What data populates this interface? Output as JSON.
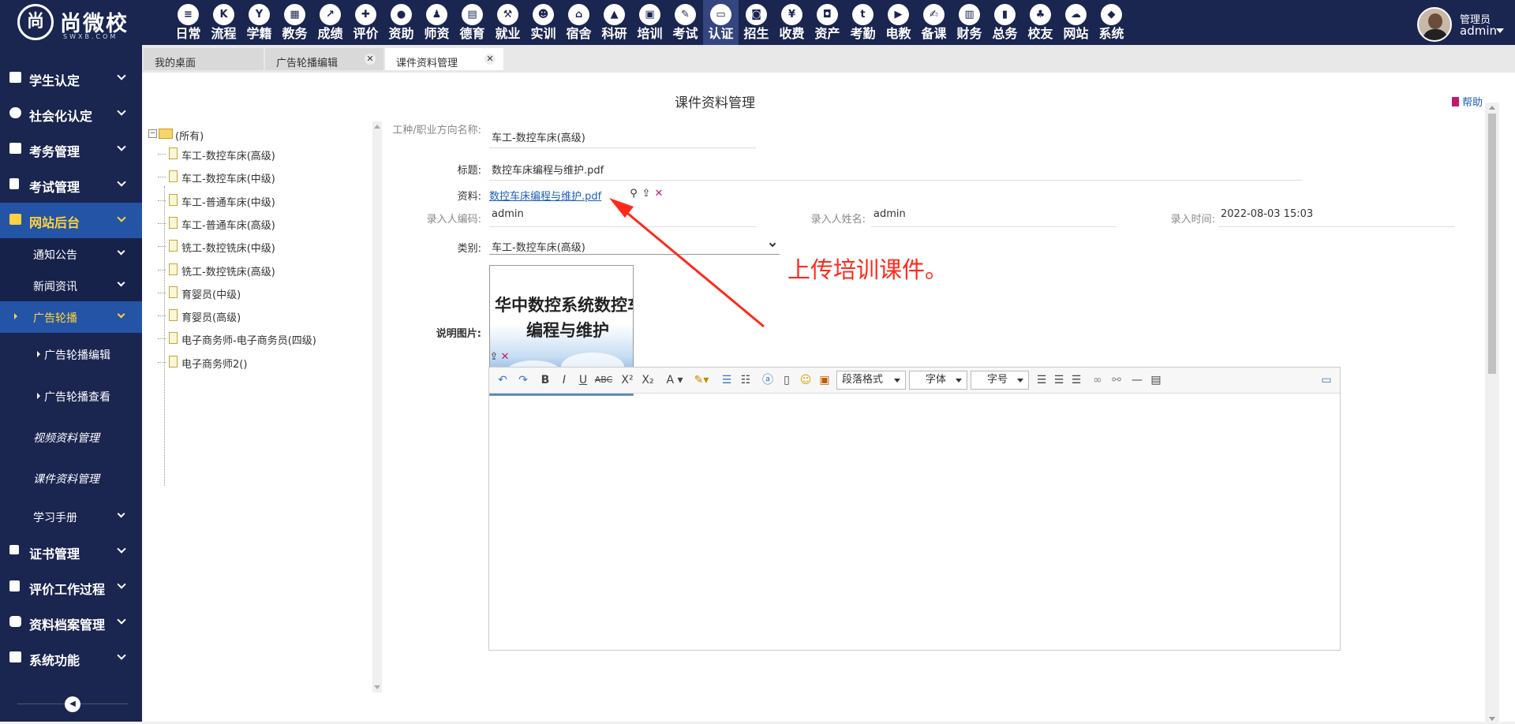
{
  "app": {
    "logo_text": "尚微校",
    "logo_sub": "SWXB.COM",
    "logo_mark": "尚"
  },
  "top_nav": [
    {
      "label": "日常",
      "icon": "doc-icon",
      "glyph": "≡"
    },
    {
      "label": "流程",
      "icon": "flow-icon",
      "glyph": "K"
    },
    {
      "label": "学籍",
      "icon": "student-icon",
      "glyph": "Y"
    },
    {
      "label": "教务",
      "icon": "calendar-icon",
      "glyph": "▦"
    },
    {
      "label": "成绩",
      "icon": "chart-icon",
      "glyph": "↗"
    },
    {
      "label": "评价",
      "icon": "evaluate-icon",
      "glyph": "✚"
    },
    {
      "label": "资助",
      "icon": "aid-icon",
      "glyph": "●"
    },
    {
      "label": "师资",
      "icon": "teacher-icon",
      "glyph": "♟"
    },
    {
      "label": "德育",
      "icon": "book-icon",
      "glyph": "▤"
    },
    {
      "label": "就业",
      "icon": "hammer-icon",
      "glyph": "⚒"
    },
    {
      "label": "实训",
      "icon": "train-icon",
      "glyph": "☻"
    },
    {
      "label": "宿舍",
      "icon": "home-icon",
      "glyph": "⌂"
    },
    {
      "label": "科研",
      "icon": "grad-cap-icon",
      "glyph": "▲"
    },
    {
      "label": "培训",
      "icon": "image-icon",
      "glyph": "▣"
    },
    {
      "label": "考试",
      "icon": "wrench-icon",
      "glyph": "✎"
    },
    {
      "label": "认证",
      "icon": "monitor-icon",
      "glyph": "▭"
    },
    {
      "label": "招生",
      "icon": "bus-icon",
      "glyph": "◙"
    },
    {
      "label": "收费",
      "icon": "yen-icon",
      "glyph": "¥"
    },
    {
      "label": "资产",
      "icon": "subway-icon",
      "glyph": "◘"
    },
    {
      "label": "考勤",
      "icon": "t-icon",
      "glyph": "t"
    },
    {
      "label": "电教",
      "icon": "video-doc-icon",
      "glyph": "▶"
    },
    {
      "label": "备课",
      "icon": "edit-icon",
      "glyph": "✍"
    },
    {
      "label": "财务",
      "icon": "newspaper-icon",
      "glyph": "▥"
    },
    {
      "label": "总务",
      "icon": "bar-chart-icon",
      "glyph": "▮"
    },
    {
      "label": "校友",
      "icon": "group-icon",
      "glyph": "♣"
    },
    {
      "label": "网站",
      "icon": "cloud-icon",
      "glyph": "☁"
    },
    {
      "label": "系统",
      "icon": "cube-icon",
      "glyph": "◆"
    }
  ],
  "active_nav": "认证",
  "user": {
    "role": "管理员",
    "name": "admin"
  },
  "sidebar": {
    "items": [
      {
        "label": "学生认定",
        "icon": "book-icon"
      },
      {
        "label": "社会化认定",
        "icon": "cloud-icon"
      },
      {
        "label": "考务管理",
        "icon": "mail-icon"
      },
      {
        "label": "考试管理",
        "icon": "file-icon"
      },
      {
        "label": "网站后台",
        "icon": "folder-icon"
      },
      {
        "label": "通知公告"
      },
      {
        "label": "新闻资讯"
      },
      {
        "label": "广告轮播"
      },
      {
        "label": "广告轮播编辑"
      },
      {
        "label": "广告轮播查看"
      },
      {
        "label": "视频资料管理"
      },
      {
        "label": "课件资料管理"
      },
      {
        "label": "学习手册"
      },
      {
        "label": "证书管理",
        "icon": "y-icon"
      },
      {
        "label": "评价工作过程",
        "icon": "columns-icon"
      },
      {
        "label": "资料档案管理",
        "icon": "circle-icon"
      },
      {
        "label": "系统功能",
        "icon": "grid-icon"
      }
    ]
  },
  "tabs": [
    {
      "label": "我的桌面"
    },
    {
      "label": "广告轮播编辑"
    },
    {
      "label": "课件资料管理"
    }
  ],
  "page": {
    "title": "课件资料管理",
    "help": "帮助"
  },
  "tree": {
    "root": "(所有)",
    "nodes": [
      "车工-数控车床(高级)",
      "车工-数控车床(中级)",
      "车工-普通车床(中级)",
      "车工-普通车床(高级)",
      "铣工-数控铣床(中级)",
      "铣工-数控铣床(高级)",
      "育婴员(中级)",
      "育婴员(高级)",
      "电子商务师-电子商务员(四级)",
      "电子商务师2()"
    ]
  },
  "form": {
    "job_label": "工种/职业方向名称:",
    "job_value": "车工-数控车床(高级)",
    "title_label": "标题:",
    "title_value": "数控车床编程与维护.pdf",
    "file_label": "资料:",
    "file_value": "数控车床编程与维护.pdf",
    "creator_code_label": "录入人编码:",
    "creator_code_value": "admin",
    "creator_name_label": "录入人姓名:",
    "creator_name_value": "admin",
    "created_time_label": "录入时间:",
    "created_time_value": "2022-08-03 15:03",
    "category_label": "类别:",
    "category_value": "车工-数控车床(高级)",
    "image_label": "说明图片:",
    "image_text_line1": "华中数控系统数控车床",
    "image_text_line2": "编程与维护"
  },
  "annotation": {
    "text": "上传培训课件。",
    "color": "#ff2a1a"
  },
  "editor": {
    "paragraph_format": "段落格式",
    "font_family": "字体",
    "font_size": "字号"
  },
  "colors": {
    "nav_bg": "#1a2550",
    "active_bg": "#2454a6",
    "highlight": "#ffd33d",
    "link": "#1e5eb8"
  }
}
